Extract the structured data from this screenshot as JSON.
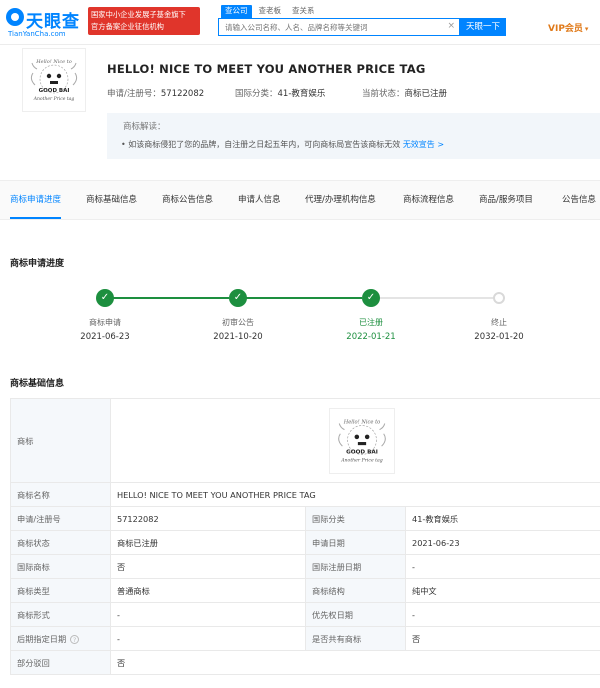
{
  "header": {
    "logo_text": "天眼查",
    "logo_sub": "TianYanCha.com",
    "banner_line1": "国家中小企业发展子基金旗下",
    "banner_line2": "官方备案企业征信机构",
    "search_tabs": [
      "查公司",
      "查老板",
      "查关系"
    ],
    "search_placeholder": "请输入公司名称、人名、品牌名称等关键词",
    "search_button": "天眼一下",
    "vip": "VIP会员"
  },
  "summary": {
    "logo_text_top": "Hello! Nice to",
    "logo_text_mid": "GOOD BAI",
    "logo_text_bottom": "Another Price tag",
    "title": "HELLO! NICE TO MEET YOU ANOTHER PRICE TAG",
    "reg_label": "申请/注册号：",
    "reg_value": "57122082",
    "class_label": "国际分类：",
    "class_value": "41-教育娱乐",
    "status_label": "当前状态：",
    "status_value": "商标已注册",
    "notice_title": "商标解读：",
    "notice_text": "• 如该商标侵犯了您的品牌，自注册之日起五年内，可向商标局宣告该商标无效 ",
    "notice_link": "无效宣告 >"
  },
  "tabs": [
    "商标申请进度",
    "商标基础信息",
    "商标公告信息",
    "申请人信息",
    "代理/办理机构信息",
    "商标流程信息",
    "商品/服务项目",
    "公告信息"
  ],
  "progress": {
    "title": "商标申请进度",
    "steps": [
      {
        "label": "商标申请",
        "date": "2021-06-23",
        "done": true
      },
      {
        "label": "初审公告",
        "date": "2021-10-20",
        "done": true
      },
      {
        "label": "已注册",
        "date": "2022-01-21",
        "done": true
      },
      {
        "label": "终止",
        "date": "2032-01-20",
        "done": false
      }
    ]
  },
  "basic_info": {
    "title": "商标基础信息",
    "logo_label": "商标",
    "name_label": "商标名称",
    "name_value": "HELLO! NICE TO MEET YOU ANOTHER PRICE TAG",
    "rows": [
      {
        "k1": "申请/注册号",
        "v1": "57122082",
        "k2": "国际分类",
        "v2": "41-教育娱乐"
      },
      {
        "k1": "商标状态",
        "v1": "商标已注册",
        "k2": "申请日期",
        "v2": "2021-06-23"
      },
      {
        "k1": "国际商标",
        "v1": "否",
        "k2": "国际注册日期",
        "v2": "-"
      },
      {
        "k1": "商标类型",
        "v1": "普通商标",
        "k2": "商标结构",
        "v2": "纯中文"
      },
      {
        "k1": "商标形式",
        "v1": "-",
        "k2": "优先权日期",
        "v2": "-"
      },
      {
        "k1": "后期指定日期",
        "v1": "-",
        "k2": "是否共有商标",
        "v2": "否"
      }
    ],
    "partial_label": "部分驳回",
    "partial_value": "否"
  }
}
